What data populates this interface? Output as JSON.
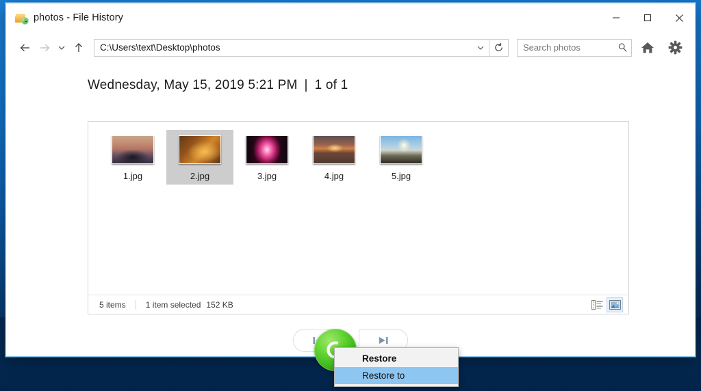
{
  "window": {
    "title": "photos - File History",
    "icon": "folder-history-icon",
    "controls": {
      "minimize": "minimize-icon",
      "maximize": "maximize-icon",
      "close": "close-icon"
    }
  },
  "toolbar": {
    "back": "back-arrow-icon",
    "forward": "forward-arrow-icon",
    "recent": "chevron-down-icon",
    "up": "up-arrow-icon",
    "address_value": "C:\\Users\\text\\Desktop\\photos",
    "address_dropdown": "chevron-down-icon",
    "refresh": "refresh-icon",
    "search_placeholder": "Search photos",
    "search_icon": "search-icon",
    "home": "home-icon",
    "settings": "gear-icon"
  },
  "header": {
    "date": "Wednesday, May 15, 2019 5:21 PM",
    "separator": "|",
    "counter": "1 of 1"
  },
  "files": [
    {
      "name": "1.jpg",
      "thumb_class": "th1",
      "selected": false
    },
    {
      "name": "2.jpg",
      "thumb_class": "th2",
      "selected": true
    },
    {
      "name": "3.jpg",
      "thumb_class": "th3",
      "selected": false
    },
    {
      "name": "4.jpg",
      "thumb_class": "th4",
      "selected": false
    },
    {
      "name": "5.jpg",
      "thumb_class": "th5",
      "selected": false
    }
  ],
  "status": {
    "item_count": "5 items",
    "selection": "1 item selected",
    "size": "152 KB",
    "view_details_icon": "details-view-icon",
    "view_large_icons_icon": "large-icons-view-icon"
  },
  "bottom_nav": {
    "previous": "previous-version-icon",
    "restore": "restore-icon",
    "next": "next-version-icon"
  },
  "context_menu": {
    "items": [
      {
        "label": "Restore",
        "bold": true,
        "highlighted": false
      },
      {
        "label": "Restore to",
        "bold": false,
        "highlighted": true
      }
    ]
  },
  "colors": {
    "accent_green": "#3db81c",
    "menu_highlight": "#8ec6f2",
    "selection_gray": "#cdcdcd",
    "desktop_blue": "#0e63b4",
    "desktop_navy": "#042a52"
  }
}
